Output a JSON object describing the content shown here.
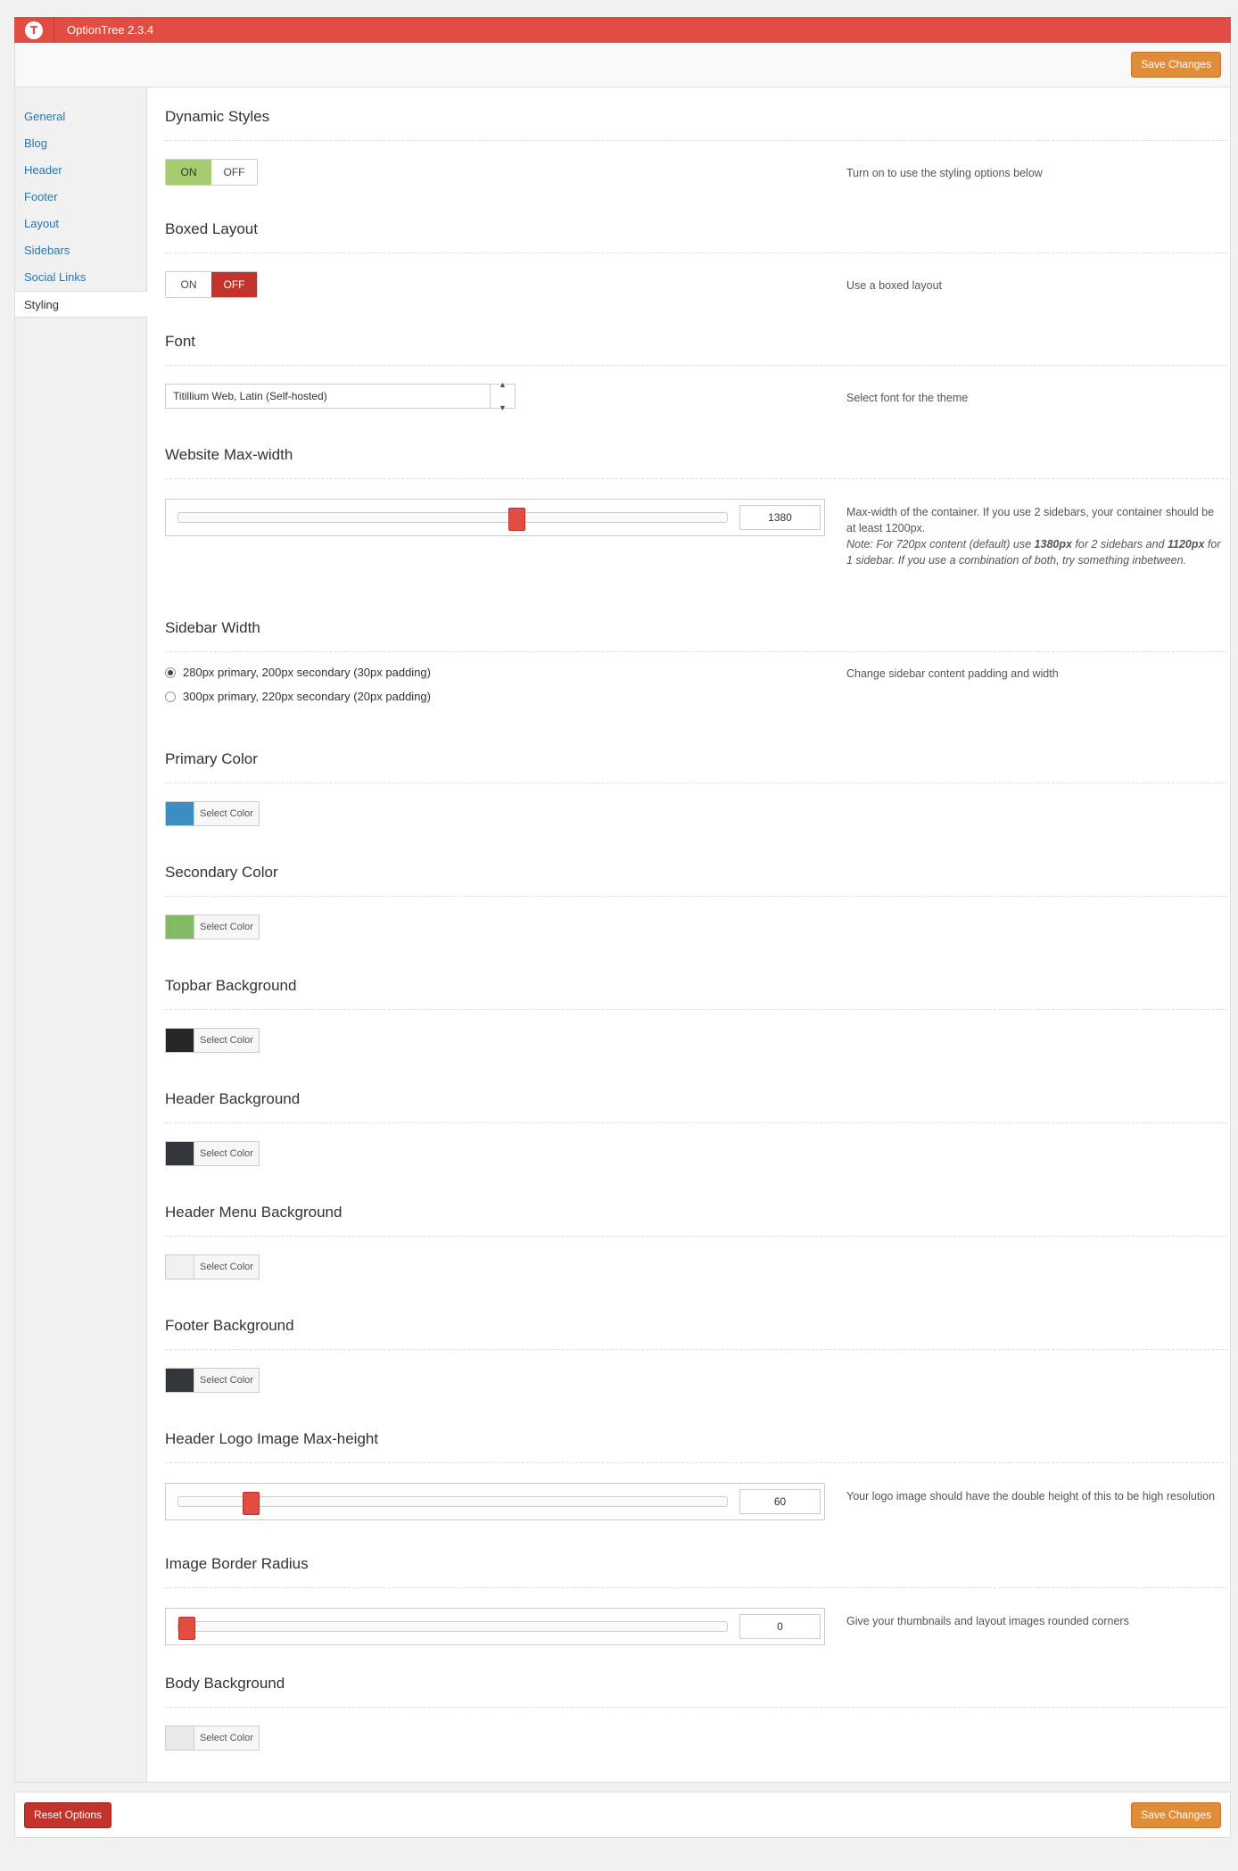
{
  "app": {
    "title": "OptionTree 2.3.4"
  },
  "actions": {
    "save_label": "Save Changes",
    "reset_label": "Reset Options"
  },
  "sidebar": {
    "items": [
      {
        "label": "General"
      },
      {
        "label": "Blog"
      },
      {
        "label": "Header"
      },
      {
        "label": "Footer"
      },
      {
        "label": "Layout"
      },
      {
        "label": "Sidebars"
      },
      {
        "label": "Social Links"
      },
      {
        "label": "Styling",
        "active": true
      }
    ]
  },
  "toggles": {
    "on_label": "ON",
    "off_label": "OFF"
  },
  "color_button_label": "Select Color",
  "sections": {
    "dynamic_styles": {
      "title": "Dynamic Styles",
      "value": "ON",
      "desc": "Turn on to use the styling options below"
    },
    "boxed_layout": {
      "title": "Boxed Layout",
      "value": "OFF",
      "desc": "Use a boxed layout"
    },
    "font": {
      "title": "Font",
      "value": "Titillium Web, Latin (Self-hosted)",
      "desc": "Select font for the theme"
    },
    "max_width": {
      "title": "Website Max-width",
      "value": "1380",
      "slider_fraction": 0.62,
      "desc_main": "Max-width of the container. If you use 2 sidebars, your container should be at least 1200px.",
      "note_a": "Note: For 720px content (default) use ",
      "note_b1": "1380px",
      "note_c": " for 2 sidebars and ",
      "note_b2": "1120px",
      "note_d": " for 1 sidebar. If you use a combination of both, try something inbetween."
    },
    "sidebar_width": {
      "title": "Sidebar Width",
      "options": [
        "280px primary, 200px secondary (30px padding)",
        "300px primary, 220px secondary (20px padding)"
      ],
      "selected": 0,
      "desc": "Change sidebar content padding and width"
    },
    "primary_color": {
      "title": "Primary Color",
      "color": "#3b8dc4"
    },
    "secondary_color": {
      "title": "Secondary Color",
      "color": "#82b965"
    },
    "topbar_bg": {
      "title": "Topbar Background",
      "color": "#26272b"
    },
    "header_bg": {
      "title": "Header Background",
      "color": "#33363b"
    },
    "header_menu_bg": {
      "title": "Header Menu Background",
      "color": "#f1f1f1"
    },
    "footer_bg": {
      "title": "Footer Background",
      "color": "#33363b"
    },
    "logo_max_height": {
      "title": "Header Logo Image Max-height",
      "value": "60",
      "slider_fraction": 0.12,
      "desc": "Your logo image should have the double height of this to be high resolution"
    },
    "border_radius": {
      "title": "Image Border Radius",
      "value": "0",
      "slider_fraction": 0.0,
      "desc": "Give your thumbnails and layout images rounded corners"
    },
    "body_bg": {
      "title": "Body Background",
      "color": "#eaeaea"
    }
  }
}
